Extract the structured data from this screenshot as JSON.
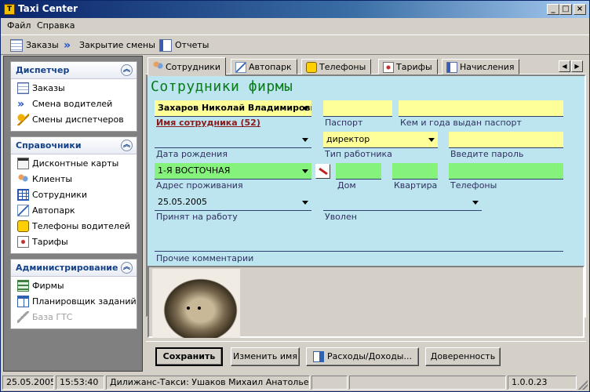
{
  "window": {
    "title": "Taxi Center",
    "app_icon_text": "T"
  },
  "menu": {
    "items": [
      "Файл",
      "Справка"
    ]
  },
  "toolbar": {
    "orders": "Заказы",
    "close_shift": "Закрытие смены",
    "reports": "Отчеты"
  },
  "sidebar": {
    "dispatcher": {
      "title": "Диспетчер",
      "items": [
        {
          "label": "Заказы",
          "icon": "orders-icon"
        },
        {
          "label": "Смена водителей",
          "icon": "driver-shift-icon"
        },
        {
          "label": "Смены диспетчеров",
          "icon": "key-icon"
        }
      ]
    },
    "references": {
      "title": "Справочники",
      "items": [
        {
          "label": "Дисконтные карты",
          "icon": "discount-card-icon"
        },
        {
          "label": "Клиенты",
          "icon": "clients-icon"
        },
        {
          "label": "Сотрудники",
          "icon": "employees-icon"
        },
        {
          "label": "Автопарк",
          "icon": "autopark-icon"
        },
        {
          "label": "Телефоны водителей",
          "icon": "phone-icon"
        },
        {
          "label": "Тарифы",
          "icon": "tariff-icon"
        }
      ]
    },
    "admin": {
      "title": "Администрирование",
      "items": [
        {
          "label": "Фирмы",
          "icon": "firm-icon"
        },
        {
          "label": "Планировщик заданий",
          "icon": "scheduler-icon"
        },
        {
          "label": "База ГТС",
          "icon": "database-icon",
          "disabled": true
        }
      ]
    }
  },
  "tabs": [
    "Сотрудники",
    "Автопарк",
    "Телефоны",
    "Тарифы",
    "Начисления"
  ],
  "form": {
    "heading": "Сотрудники фирмы",
    "employee_name": "Захаров Николай Владимирович",
    "employee_name_label": "Имя сотрудника (52)",
    "passport": "",
    "passport_label": "Паспорт",
    "passport_issued": "",
    "passport_issued_label": "Кем и года выдан паспорт",
    "birth_date": "",
    "birth_date_label": "Дата рождения",
    "worker_type": "директор",
    "worker_type_label": "Тип работника",
    "password": "",
    "password_label": "Введите пароль",
    "address": "1-Я ВОСТОЧНАЯ",
    "address_label": "Адрес проживания",
    "house": "",
    "house_label": "Дом",
    "apartment": "",
    "apartment_label": "Квартира",
    "phones": "",
    "phones_label": "Телефоны",
    "hired_date": "25.05.2005",
    "hired_label": "Принят на работу",
    "fired": "",
    "fired_label": "Уволен",
    "comments": "",
    "comments_label": "Прочие комментарии"
  },
  "buttons": {
    "save": "Сохранить",
    "rename": "Изменить имя",
    "expenses": "Расходы/Доходы...",
    "power_of_attorney": "Доверенность"
  },
  "status": {
    "date": "25.05.2005",
    "time": "15:53:40",
    "user": "Дилижанс-Такси: Ушаков Михаил Анатольевич",
    "empty": "",
    "version": "1.0.0.23"
  },
  "colors": {
    "title_bar": "#0a246a",
    "form_bg": "#bde5f0",
    "yellow_field": "#ffff99",
    "green_field": "#85f27c",
    "heading": "#0a7a1a"
  }
}
